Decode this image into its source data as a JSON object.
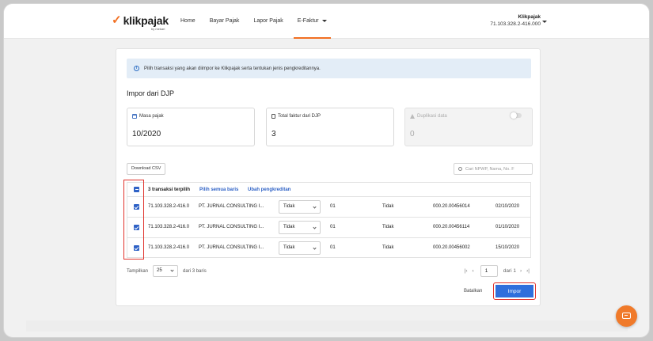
{
  "brand": {
    "logo": "klikpajak",
    "sub": "by mekari"
  },
  "nav": [
    {
      "label": "Home"
    },
    {
      "label": "Bayar Pajak"
    },
    {
      "label": "Lapor Pajak"
    },
    {
      "label": "E-Faktur"
    }
  ],
  "account": {
    "name": "Klikpajak",
    "npwp": "71.103.328.2-416.000"
  },
  "info": {
    "text": "Pilih transaksi yang akan diimpor ke Klikpajak serta tentukan jenis pengkreditannya."
  },
  "page_title": "Impor dari DJP",
  "summary": {
    "masa": {
      "label": "Masa pajak",
      "value": "10/2020"
    },
    "total": {
      "label": "Total faktur dari DJP",
      "value": "3"
    },
    "dupe": {
      "label": "Duplikasi data",
      "value": "0"
    }
  },
  "toolbar": {
    "csv_label": "Download CSV",
    "search_placeholder": "Cari NPWP, Nama, No. F"
  },
  "table": {
    "selected_text": "3 transaksi terpilih",
    "select_all": "Pilih semua baris",
    "change_credit": "Ubah pengkreditan",
    "rows": [
      {
        "npwp": "71.103.328.2-416.0",
        "name": "PT. JURNAL CONSULTING I...",
        "credit": "Tidak",
        "code": "01",
        "status": "Tidak",
        "faktur": "000.20.00456014",
        "date": "02/10/2020"
      },
      {
        "npwp": "71.103.328.2-416.0",
        "name": "PT. JURNAL CONSULTING I...",
        "credit": "Tidak",
        "code": "01",
        "status": "Tidak",
        "faktur": "000.20.00456114",
        "date": "01/10/2020"
      },
      {
        "npwp": "71.103.328.2-416.0",
        "name": "PT. JURNAL CONSULTING I...",
        "credit": "Tidak",
        "code": "01",
        "status": "Tidak",
        "faktur": "000.20.00456002",
        "date": "15/10/2020"
      }
    ]
  },
  "pagination": {
    "show_label": "Tampilkan",
    "per_page": "25",
    "of_rows": "dari 3 baris",
    "page": "1",
    "of_pages": "dari 1"
  },
  "actions": {
    "cancel": "Batalkan",
    "import": "Impor"
  },
  "colors": {
    "accent": "#f26f21",
    "primary": "#2f6fdc",
    "highlight": "#e0322b"
  }
}
